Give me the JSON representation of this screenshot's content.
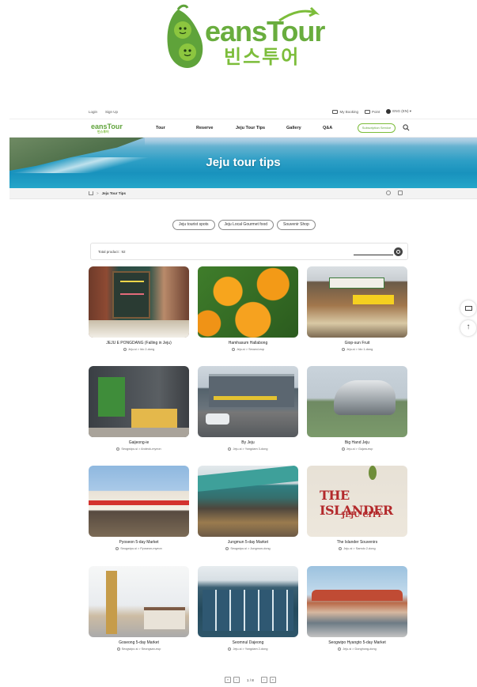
{
  "brand": {
    "logo_word": "eansTour",
    "logo_korean": "빈스투어",
    "nav_logo_word": "eansTour",
    "nav_logo_korean": "빈스투어",
    "green": "#69ad3e"
  },
  "utility": {
    "login": "Login",
    "signup": "Sign Up",
    "my_booking": "My Booking",
    "point": "Point",
    "language": "ENG (EN) ▾"
  },
  "nav": {
    "items": [
      "Tour",
      "Reserve",
      "Jeju Tour Tips",
      "Gallery",
      "Q&A"
    ],
    "subscription": "Subscription Service"
  },
  "banner": {
    "title": "Jeju tour tips"
  },
  "breadcrumb": {
    "current": "Jeju Tour Tips"
  },
  "chips": [
    "Jeju tourist spots",
    "Jeju Local Gourmet food",
    "Souvenir Shop"
  ],
  "total": {
    "text": "Total product : 92"
  },
  "products": [
    {
      "name": "JEJU E PONGDANG (Falling in Jeju)",
      "loc": "Jeju-si > Ido 2-dong"
    },
    {
      "name": "Hamhasum Hallabong",
      "loc": "Jeju-si > Seowol-eup"
    },
    {
      "name": "Giop-sun Fruit",
      "loc": "Jeju-si > Ido 1-dong"
    },
    {
      "name": "Gaijeong-ie",
      "loc": "Seogwipo-si > Andeok-myeon"
    },
    {
      "name": "By Jeju",
      "loc": "Jeju-si > Yongdam 3-dong"
    },
    {
      "name": "Big Hand Jeju",
      "loc": "Jeju-si > Gujwa-eup"
    },
    {
      "name": "Pyoseon 5-day Market",
      "loc": "Seogwipo-si > Pyoseon-myeon"
    },
    {
      "name": "Jungmun 5-day Market",
      "loc": "Seogwipo-si > Jungmun-dong"
    },
    {
      "name": "The Islander Souvenirs",
      "loc": "Jeju-si > Samdo 2-dong"
    },
    {
      "name": "Goseong 5-day Market",
      "loc": "Seogwipo-si > Seongsan-eup"
    },
    {
      "name": "Seomnul Dajeong",
      "loc": "Jeju-si > Yongdam 2-dong"
    },
    {
      "name": "Seogwipo Hyangto 5-day Market",
      "loc": "Jeju-si > Donghong-dong"
    }
  ],
  "sign_texts": {
    "islander_1": "THE ISLANDER",
    "islander_2": "JEJU CITY"
  },
  "pager": {
    "current": "1 / 8"
  }
}
